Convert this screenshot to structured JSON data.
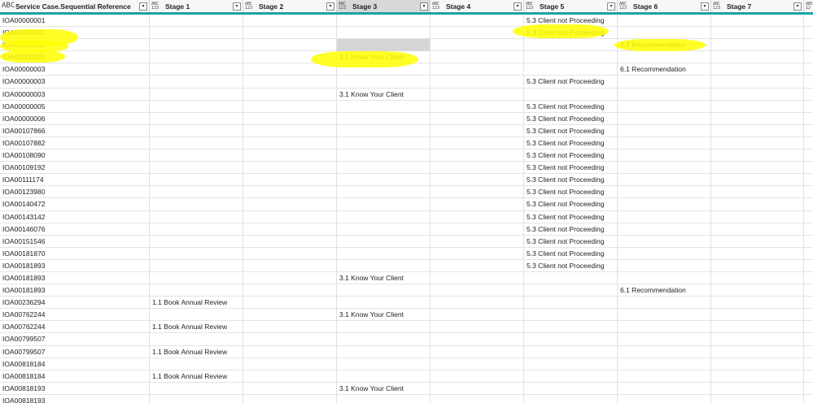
{
  "columns": [
    {
      "title": "Service Case.Sequential Reference",
      "type_icon": "ABC",
      "filter_glyph": "▾",
      "sort": "sort-ascending-icon"
    },
    {
      "title": "Stage 1",
      "type_icon": "ABC\n123",
      "filter_glyph": "▾"
    },
    {
      "title": "Stage 2",
      "type_icon": "ABC\n123",
      "filter_glyph": "▾"
    },
    {
      "title": "Stage 3",
      "type_icon": "ABC\n123",
      "filter_glyph": "▾",
      "selected": true
    },
    {
      "title": "Stage 4",
      "type_icon": "ABC\n123",
      "filter_glyph": "▾"
    },
    {
      "title": "Stage 5",
      "type_icon": "ABC\n123",
      "filter_glyph": "▾"
    },
    {
      "title": "Stage 6",
      "type_icon": "ABC\n123",
      "filter_glyph": "▾"
    },
    {
      "title": "Stage 7",
      "type_icon": "ABC\n123",
      "filter_glyph": "▾"
    },
    {
      "title": "",
      "type_icon": "ABC\n12",
      "filter_glyph": ""
    }
  ],
  "rows": [
    [
      "IOA00000001",
      "",
      "",
      "",
      "",
      "5.3 Client not Proceeding",
      "",
      ""
    ],
    [
      "IOA00000002",
      "",
      "",
      "",
      "",
      "5.3 Client not Proceeding",
      "",
      ""
    ],
    [
      "IOA00000002",
      "",
      "",
      "",
      "",
      "",
      "6.1 Recommendation",
      ""
    ],
    [
      "IOA00000002",
      "",
      "",
      "3.1 Know Your Client",
      "",
      "",
      "",
      ""
    ],
    [
      "IOA00000003",
      "",
      "",
      "",
      "",
      "",
      "6.1 Recommendation",
      ""
    ],
    [
      "IOA00000003",
      "",
      "",
      "",
      "",
      "5.3 Client not Proceeding",
      "",
      ""
    ],
    [
      "IOA00000003",
      "",
      "",
      "3.1 Know Your Client",
      "",
      "",
      "",
      ""
    ],
    [
      "IOA00000005",
      "",
      "",
      "",
      "",
      "5.3 Client not Proceeding",
      "",
      ""
    ],
    [
      "IOA00000006",
      "",
      "",
      "",
      "",
      "5.3 Client not Proceeding",
      "",
      ""
    ],
    [
      "IOA00107866",
      "",
      "",
      "",
      "",
      "5.3 Client not Proceeding",
      "",
      ""
    ],
    [
      "IOA00107882",
      "",
      "",
      "",
      "",
      "5.3 Client not Proceeding",
      "",
      ""
    ],
    [
      "IOA00108090",
      "",
      "",
      "",
      "",
      "5.3 Client not Proceeding",
      "",
      ""
    ],
    [
      "IOA00109192",
      "",
      "",
      "",
      "",
      "5.3 Client not Proceeding",
      "",
      ""
    ],
    [
      "IOA00111174",
      "",
      "",
      "",
      "",
      "5.3 Client not Proceeding",
      "",
      ""
    ],
    [
      "IOA00123980",
      "",
      "",
      "",
      "",
      "5.3 Client not Proceeding",
      "",
      ""
    ],
    [
      "IOA00140472",
      "",
      "",
      "",
      "",
      "5.3 Client not Proceeding",
      "",
      ""
    ],
    [
      "IOA00143142",
      "",
      "",
      "",
      "",
      "5.3 Client not Proceeding",
      "",
      ""
    ],
    [
      "IOA00146076",
      "",
      "",
      "",
      "",
      "5.3 Client not Proceeding",
      "",
      ""
    ],
    [
      "IOA00151546",
      "",
      "",
      "",
      "",
      "5.3 Client not Proceeding",
      "",
      ""
    ],
    [
      "IOA00181870",
      "",
      "",
      "",
      "",
      "5.3 Client not Proceeding",
      "",
      ""
    ],
    [
      "IOA00181893",
      "",
      "",
      "",
      "",
      "5.3 Client not Proceeding",
      "",
      ""
    ],
    [
      "IOA00181893",
      "",
      "",
      "3.1 Know Your Client",
      "",
      "",
      "",
      ""
    ],
    [
      "IOA00181893",
      "",
      "",
      "",
      "",
      "",
      "6.1 Recommendation",
      ""
    ],
    [
      "IOA00236294",
      "1.1 Book Annual Review",
      "",
      "",
      "",
      "",
      "",
      ""
    ],
    [
      "IOA00762244",
      "",
      "",
      "3.1 Know Your Client",
      "",
      "",
      "",
      ""
    ],
    [
      "IOA00762244",
      "1.1 Book Annual Review",
      "",
      "",
      "",
      "",
      "",
      ""
    ],
    [
      "IOA00799507",
      "",
      "",
      "",
      "",
      "",
      "",
      ""
    ],
    [
      "IOA00799507",
      "1.1 Book Annual Review",
      "",
      "",
      "",
      "",
      "",
      ""
    ],
    [
      "IOA00818184",
      "",
      "",
      "",
      "",
      "",
      "",
      ""
    ],
    [
      "IOA00818184",
      "1.1 Book Annual Review",
      "",
      "",
      "",
      "",
      "",
      ""
    ],
    [
      "IOA00818193",
      "",
      "",
      "3.1 Know Your Client",
      "",
      "",
      "",
      ""
    ],
    [
      "IOA00818193",
      "",
      "",
      "",
      "",
      "",
      "",
      ""
    ]
  ],
  "colors": {
    "header_accent": "#1aa3a3",
    "highlight": "#ffff00",
    "selected_column": "#d8d8d8",
    "empty_cell_gray": "#d5d5d5"
  }
}
